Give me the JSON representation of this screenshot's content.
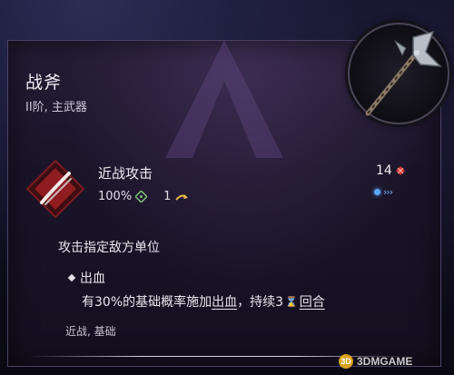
{
  "item": {
    "name": "战斧",
    "subtitle": "II阶, 主武器",
    "icon": "battle-axe-icon"
  },
  "skill": {
    "name": "近战攻击",
    "accuracy": "100%",
    "range": "1",
    "ap_cost": "14",
    "icon": "slash-attack-icon",
    "description": "攻击指定敌方单位"
  },
  "effect": {
    "name": "出血",
    "text_prefix": "有30%的基础概率施加",
    "link_bleed": "出血",
    "text_mid": "，持续3",
    "link_rounds": "回合"
  },
  "tags": "近战, 基础",
  "watermark": "3DMGAME",
  "colors": {
    "accent_blue": "#5aa8ff",
    "accent_red": "#d23a3a",
    "panel_border": "#4b4265"
  }
}
